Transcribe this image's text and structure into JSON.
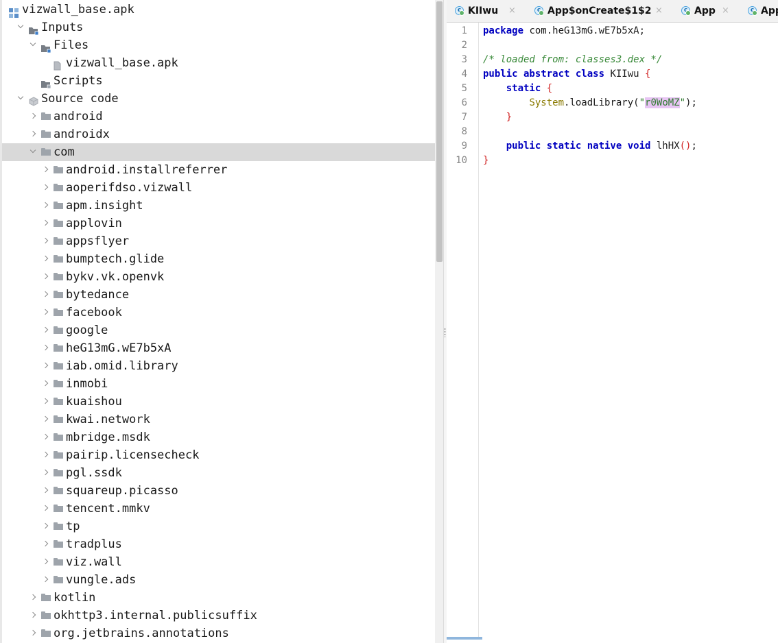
{
  "tree": {
    "rows": [
      {
        "label": "vizwall_base.apk",
        "depth": 0,
        "chevron": "none",
        "icon": "apk-project-icon"
      },
      {
        "label": "Inputs",
        "depth": 1,
        "chevron": "down",
        "icon": "inputs-folder-icon"
      },
      {
        "label": "Files",
        "depth": 2,
        "chevron": "down",
        "icon": "files-folder-icon"
      },
      {
        "label": "vizwall_base.apk",
        "depth": 3,
        "chevron": "none",
        "icon": "file-icon"
      },
      {
        "label": "Scripts",
        "depth": 2,
        "chevron": "none",
        "icon": "scripts-folder-icon"
      },
      {
        "label": "Source code",
        "depth": 1,
        "chevron": "down",
        "icon": "source-code-icon"
      },
      {
        "label": "android",
        "depth": 2,
        "chevron": "right",
        "icon": "package-icon"
      },
      {
        "label": "androidx",
        "depth": 2,
        "chevron": "right",
        "icon": "package-icon"
      },
      {
        "label": "com",
        "depth": 2,
        "chevron": "down",
        "icon": "package-icon",
        "selected": true
      },
      {
        "label": "android.installreferrer",
        "depth": 3,
        "chevron": "right",
        "icon": "package-icon"
      },
      {
        "label": "aoperifdso.vizwall",
        "depth": 3,
        "chevron": "right",
        "icon": "package-icon"
      },
      {
        "label": "apm.insight",
        "depth": 3,
        "chevron": "right",
        "icon": "package-icon"
      },
      {
        "label": "applovin",
        "depth": 3,
        "chevron": "right",
        "icon": "package-icon"
      },
      {
        "label": "appsflyer",
        "depth": 3,
        "chevron": "right",
        "icon": "package-icon"
      },
      {
        "label": "bumptech.glide",
        "depth": 3,
        "chevron": "right",
        "icon": "package-icon"
      },
      {
        "label": "bykv.vk.openvk",
        "depth": 3,
        "chevron": "right",
        "icon": "package-icon"
      },
      {
        "label": "bytedance",
        "depth": 3,
        "chevron": "right",
        "icon": "package-icon"
      },
      {
        "label": "facebook",
        "depth": 3,
        "chevron": "right",
        "icon": "package-icon"
      },
      {
        "label": "google",
        "depth": 3,
        "chevron": "right",
        "icon": "package-icon"
      },
      {
        "label": "heG13mG.wE7b5xA",
        "depth": 3,
        "chevron": "right",
        "icon": "package-icon"
      },
      {
        "label": "iab.omid.library",
        "depth": 3,
        "chevron": "right",
        "icon": "package-icon"
      },
      {
        "label": "inmobi",
        "depth": 3,
        "chevron": "right",
        "icon": "package-icon"
      },
      {
        "label": "kuaishou",
        "depth": 3,
        "chevron": "right",
        "icon": "package-icon"
      },
      {
        "label": "kwai.network",
        "depth": 3,
        "chevron": "right",
        "icon": "package-icon"
      },
      {
        "label": "mbridge.msdk",
        "depth": 3,
        "chevron": "right",
        "icon": "package-icon"
      },
      {
        "label": "pairip.licensecheck",
        "depth": 3,
        "chevron": "right",
        "icon": "package-icon"
      },
      {
        "label": "pgl.ssdk",
        "depth": 3,
        "chevron": "right",
        "icon": "package-icon"
      },
      {
        "label": "squareup.picasso",
        "depth": 3,
        "chevron": "right",
        "icon": "package-icon"
      },
      {
        "label": "tencent.mmkv",
        "depth": 3,
        "chevron": "right",
        "icon": "package-icon"
      },
      {
        "label": "tp",
        "depth": 3,
        "chevron": "right",
        "icon": "package-icon"
      },
      {
        "label": "tradplus",
        "depth": 3,
        "chevron": "right",
        "icon": "package-icon"
      },
      {
        "label": "viz.wall",
        "depth": 3,
        "chevron": "right",
        "icon": "package-icon"
      },
      {
        "label": "vungle.ads",
        "depth": 3,
        "chevron": "right",
        "icon": "package-icon"
      },
      {
        "label": "kotlin",
        "depth": 2,
        "chevron": "right",
        "icon": "package-icon"
      },
      {
        "label": "okhttp3.internal.publicsuffix",
        "depth": 2,
        "chevron": "right",
        "icon": "package-icon"
      },
      {
        "label": "org.jetbrains.annotations",
        "depth": 2,
        "chevron": "right",
        "icon": "package-icon"
      }
    ]
  },
  "editor": {
    "tabs": [
      {
        "label": "KIIwu",
        "icon": "class-icon",
        "close": "×"
      },
      {
        "label": "App$onCreate$1$2",
        "icon": "class-icon",
        "close": "×"
      },
      {
        "label": "App",
        "icon": "class-icon",
        "close": "×"
      },
      {
        "label": "App",
        "icon": "class-icon",
        "close": ""
      }
    ],
    "line_numbers": [
      "1",
      "2",
      "3",
      "4",
      "5",
      "6",
      "7",
      "8",
      "9",
      "10"
    ],
    "code": {
      "l1_kw": "package",
      "l1_rest": " com.heG13mG.wE7b5xA;",
      "l3_comment": "/* loaded from: classes3.dex */",
      "l4_kw": "public abstract class",
      "l4_name": " KIIwu ",
      "l4_brace": "{",
      "l5_indent": "    ",
      "l5_kw": "static",
      "l5_brace": " {",
      "l6_indent": "        ",
      "l6_class": "System",
      "l6_call": ".loadLibrary(",
      "l6_q1": "\"",
      "l6_str": "r0WoMZ",
      "l6_q2": "\"",
      "l6_end": ");",
      "l7_indent": "    ",
      "l7_brace": "}",
      "l9_indent": "    ",
      "l9_kw": "public static native void",
      "l9_name": " lhHX",
      "l9_paren": "()",
      "l9_end": ";",
      "l10_brace": "}"
    }
  },
  "colors": {
    "keyword": "#0000c0",
    "comment": "#3a8a3a",
    "brace": "#d02020",
    "class_ref": "#8a7a00",
    "string": "#2e7a2e",
    "highlight": "#e7c4f3",
    "selection": "#d9d9d9"
  }
}
